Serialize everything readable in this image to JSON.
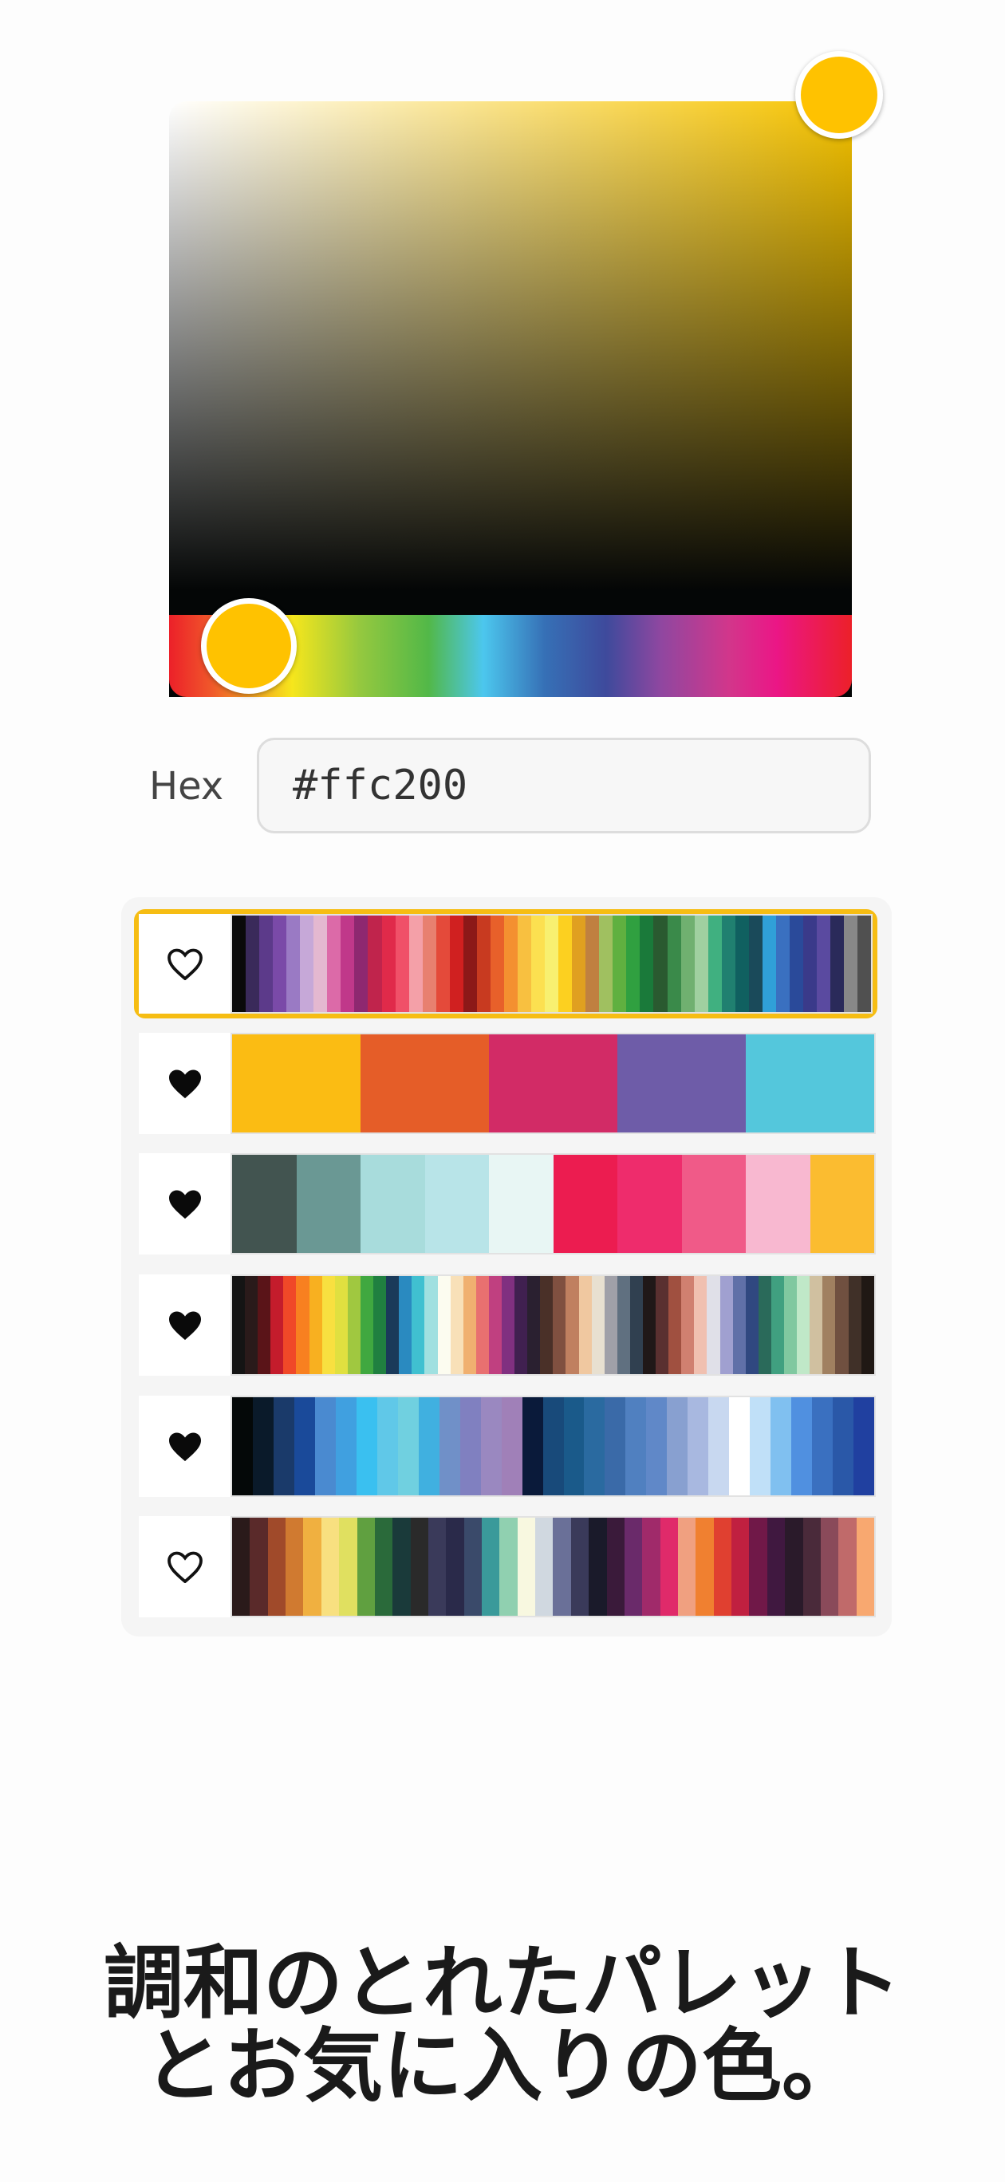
{
  "picker": {
    "current_color": "#ffc200",
    "hue_color": "#f7c400",
    "saturation": 1.0,
    "brightness": 1.0,
    "hue_position": 0.12
  },
  "hex": {
    "label": "Hex",
    "value": "#ffc200"
  },
  "palettes": [
    {
      "favorite": false,
      "selected": true,
      "heart_icon": "heart-outline-icon",
      "colors": [
        "#0a0a0a",
        "#3a2a5a",
        "#5c3a8a",
        "#7a4aa8",
        "#9a7ac4",
        "#c6a8d8",
        "#e4b8d0",
        "#dc6aa8",
        "#c0388a",
        "#8e2870",
        "#c0244c",
        "#e02a4a",
        "#f05068",
        "#f4a0a8",
        "#e88070",
        "#e44a3a",
        "#d02020",
        "#8c1818",
        "#c83a20",
        "#e8602a",
        "#f49030",
        "#f8c040",
        "#fce050",
        "#f8f070",
        "#fcd020",
        "#e0a020",
        "#c08040",
        "#a0c060",
        "#60b040",
        "#30a040",
        "#1a7a3a",
        "#2a5a30",
        "#3a8a4a",
        "#70b070",
        "#a0d0a0",
        "#40b080",
        "#208070",
        "#106060",
        "#1a4a5a",
        "#30a0d8",
        "#3a70c0",
        "#2a4a9a",
        "#3a3a8a",
        "#5a4aa0",
        "#2a2a5a",
        "#888888",
        "#505050"
      ]
    },
    {
      "favorite": true,
      "selected": false,
      "heart_icon": "heart-filled-icon",
      "colors": [
        "#fbbc13",
        "#e55d28",
        "#d22b66",
        "#6e5ca8",
        "#54c7dc"
      ]
    },
    {
      "favorite": true,
      "selected": false,
      "heart_icon": "heart-filled-icon",
      "colors": [
        "#425450",
        "#6a9894",
        "#a8dcdc",
        "#b8e4e8",
        "#e8f6f4",
        "#ec1c50",
        "#ee2c6c",
        "#f05a88",
        "#f8b8d0",
        "#fbbc30"
      ]
    },
    {
      "favorite": true,
      "selected": false,
      "heart_icon": "heart-filled-icon",
      "colors": [
        "#141414",
        "#2a1a1a",
        "#5a1418",
        "#c41c2c",
        "#f04828",
        "#f88020",
        "#f8b020",
        "#f8e040",
        "#e0e040",
        "#a0c840",
        "#40a840",
        "#208040",
        "#1a3a5a",
        "#2a8ac0",
        "#40c0d0",
        "#a0e0e0",
        "#fcfcf0",
        "#f8e0b8",
        "#f0b070",
        "#e87070",
        "#c04080",
        "#803080",
        "#402050",
        "#2a2030",
        "#4a3028",
        "#805040",
        "#c08060",
        "#f0c8a0",
        "#e8e0d0",
        "#a0a0a8",
        "#607080",
        "#304050",
        "#201818",
        "#5a3030",
        "#a05040",
        "#d08070",
        "#f0c0b0",
        "#e0e0e8",
        "#a0a0d0",
        "#6070a8",
        "#304880",
        "#2a6a5a",
        "#40a080",
        "#80c8a0",
        "#c0e8c8",
        "#d0c0a0",
        "#a08060",
        "#705040",
        "#403028",
        "#201814"
      ]
    },
    {
      "favorite": true,
      "selected": false,
      "heart_icon": "heart-filled-icon",
      "colors": [
        "#040808",
        "#0a1a2a",
        "#1a3a6a",
        "#1a4a9a",
        "#4a8ad0",
        "#40a0e0",
        "#3ac0f0",
        "#60c8e8",
        "#70d0e0",
        "#40b0e0",
        "#7090c8",
        "#8080c0",
        "#9a88c0",
        "#a080b8",
        "#0a1a3a",
        "#184a7a",
        "#1a5a8a",
        "#2a6aa0",
        "#3a6aa8",
        "#5080c0",
        "#6088c8",
        "#88a0d0",
        "#a8b8e0",
        "#c8d8f0",
        "#ffffff",
        "#c0e0f8",
        "#80c0f0",
        "#5090e0",
        "#3a70c0",
        "#2a58a8",
        "#2040a0"
      ]
    },
    {
      "favorite": false,
      "selected": false,
      "heart_icon": "heart-outline-icon",
      "colors": [
        "#2a1a1a",
        "#5a2a2a",
        "#a04a2a",
        "#d07a30",
        "#f0b040",
        "#f8e080",
        "#e0e060",
        "#60a040",
        "#2a6a3a",
        "#1a3a3a",
        "#2a2a2a",
        "#3a3a5a",
        "#2a2a4a",
        "#3a4a6a",
        "#3a9a9a",
        "#90d0b0",
        "#f8f8e0",
        "#d0d8e0",
        "#6a7098",
        "#3a3a5a",
        "#1a1a2a",
        "#3a1a3a",
        "#6a2a6a",
        "#a02a6a",
        "#e02a6a",
        "#f0a080",
        "#f08030",
        "#e04030",
        "#c02040",
        "#701848",
        "#401840",
        "#2a1a2a",
        "#4a2a3a",
        "#8a4a5a",
        "#c06a6a",
        "#f8a870"
      ]
    }
  ],
  "caption": {
    "line1": "調和のとれたパレット",
    "line2": "とお気に入りの色。"
  }
}
